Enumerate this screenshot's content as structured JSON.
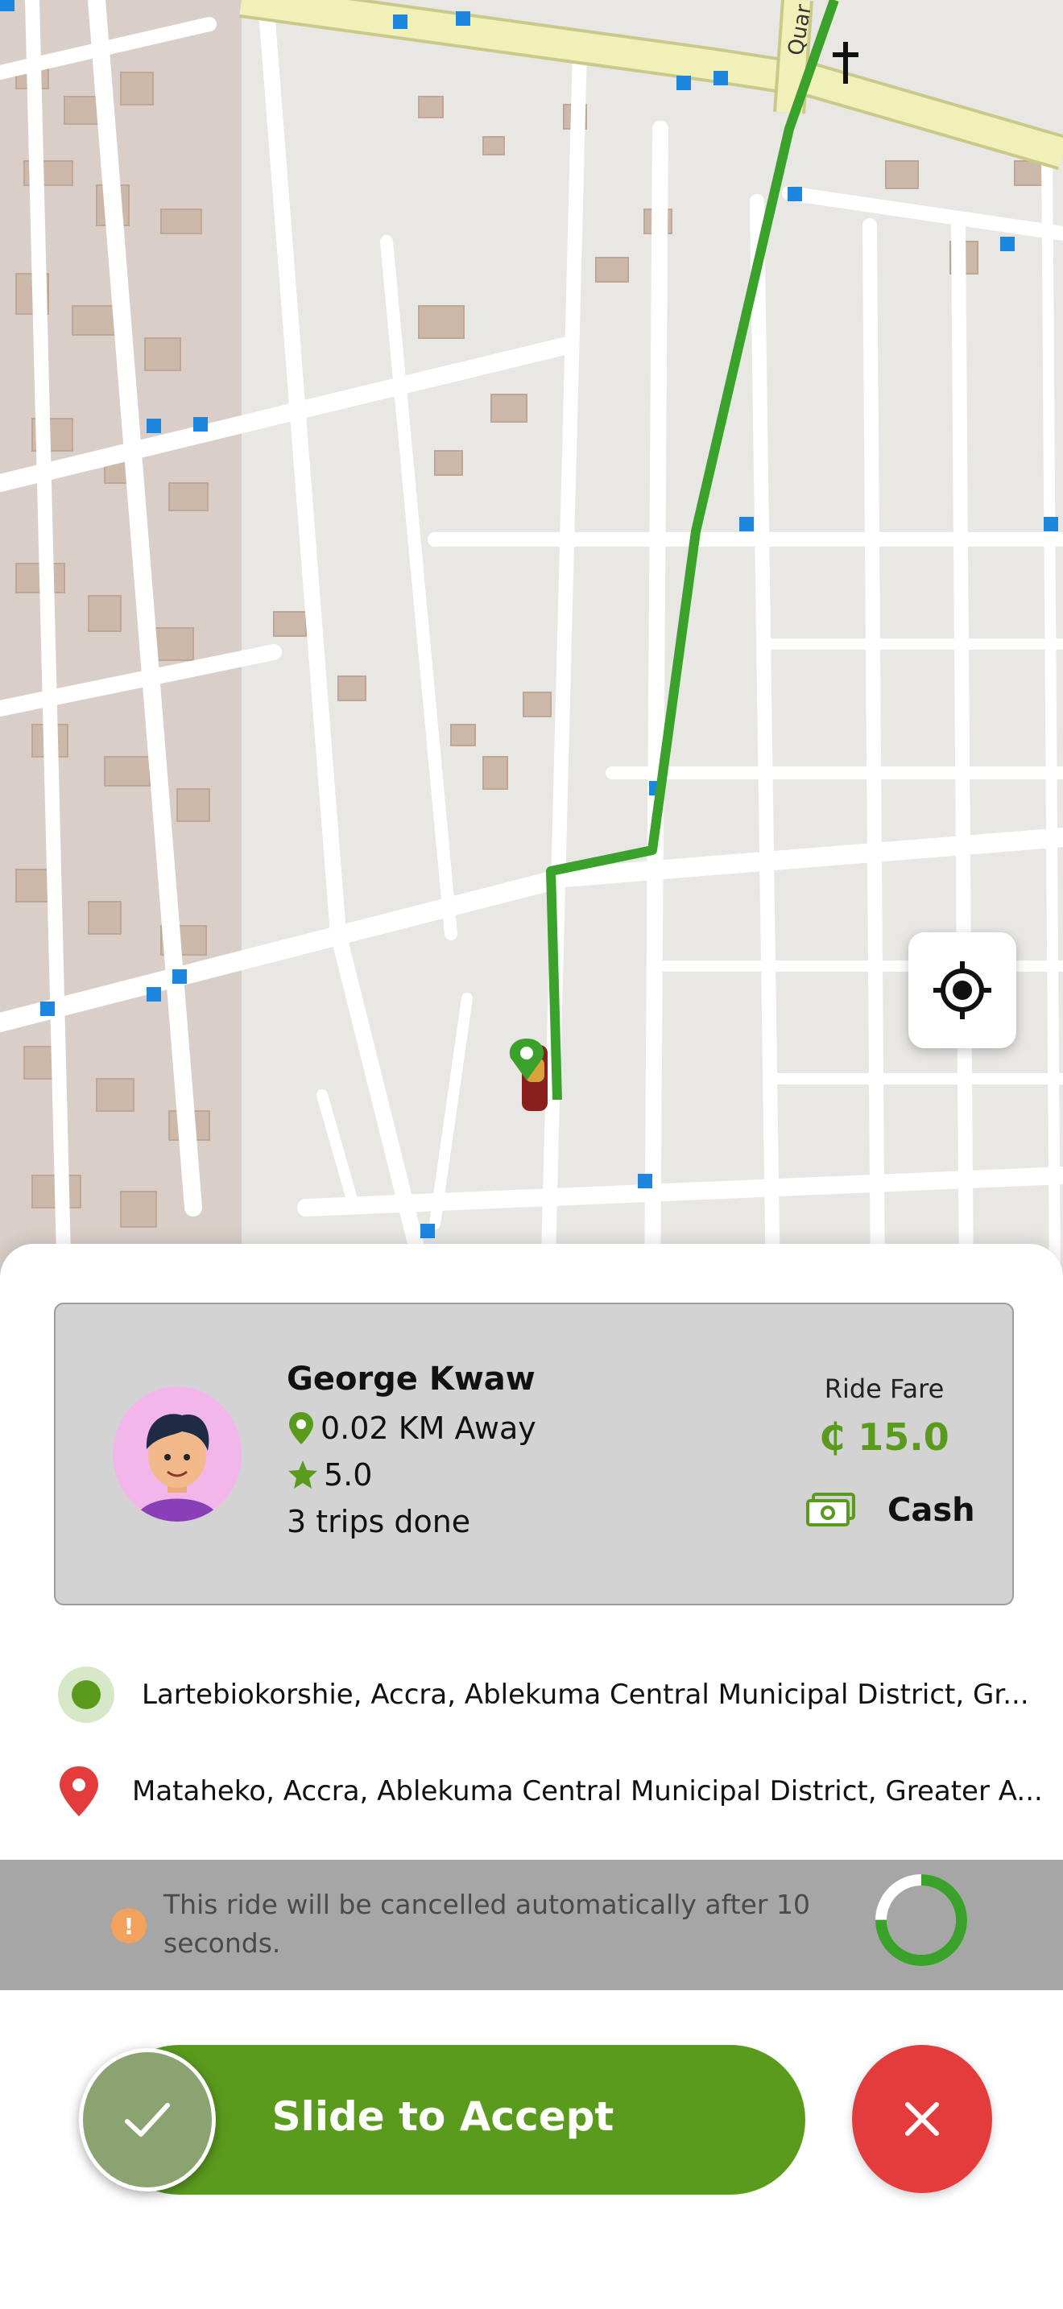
{
  "map": {
    "road_label": "Quar",
    "route_color": "#3aa22a",
    "pickup_pin_color": "#3aa22a",
    "locate_button_icon": "crosshair-icon",
    "landmark_icon": "church-cross-icon"
  },
  "rider": {
    "name": "George Kwaw",
    "distance": "0.02 KM Away",
    "rating": "5.0",
    "trips": "3 trips done",
    "distance_icon": "location-pin-icon",
    "rating_icon": "star-icon",
    "avatar_icon": "user-avatar"
  },
  "fare": {
    "title": "Ride Fare",
    "value": "₵ 15.0",
    "payment_method": "Cash",
    "payment_icon": "cash-icon",
    "accent_color": "#5a9b1e"
  },
  "trip": {
    "pickup": "Lartebiokorshie, Accra, Ablekuma Central Municipal District, Gr...",
    "dropoff": "Mataheko, Accra, Ablekuma Central Municipal District, Greater A...",
    "pickup_icon": "pickup-dot-icon",
    "dropoff_icon": "destination-pin-icon"
  },
  "auto_cancel": {
    "message": "This ride will be cancelled automatically after 10 seconds.",
    "icon": "info-icon",
    "remaining_fraction": 0.75
  },
  "actions": {
    "accept_label": "Slide to Accept",
    "accept_icon": "checkmark-icon",
    "reject_icon": "close-icon",
    "accept_color": "#5a9b1e",
    "reject_color": "#e43c3c"
  }
}
